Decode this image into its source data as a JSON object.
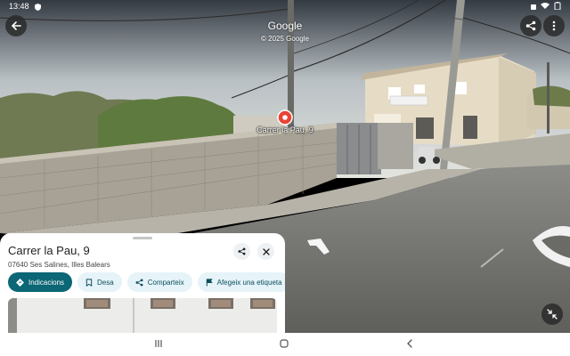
{
  "status_bar": {
    "time": "13:48"
  },
  "header": {
    "brand": "Google",
    "copyright": "© 2025 Google"
  },
  "location": {
    "pin_label": "Carrer la Pau, 9",
    "title": "Carrer la Pau, 9",
    "address": "07640 Ses Salines, Illes Balears"
  },
  "actions": {
    "directions_label": "Indicacions",
    "save_label": "Desa",
    "share_label": "Comparteix",
    "add_label_label": "Afegeix una etiqueta"
  },
  "icons": {
    "back": "arrow-left-icon",
    "share": "share-icon",
    "more": "more-vert-icon",
    "close": "close-icon",
    "collapse": "collapse-icon",
    "recents": "recents-icon",
    "home": "home-icon",
    "nav_back": "chevron-left-icon"
  },
  "colors": {
    "primary": "#0b6675",
    "chip": "#e6f3f8",
    "pin": "#ea4335"
  }
}
